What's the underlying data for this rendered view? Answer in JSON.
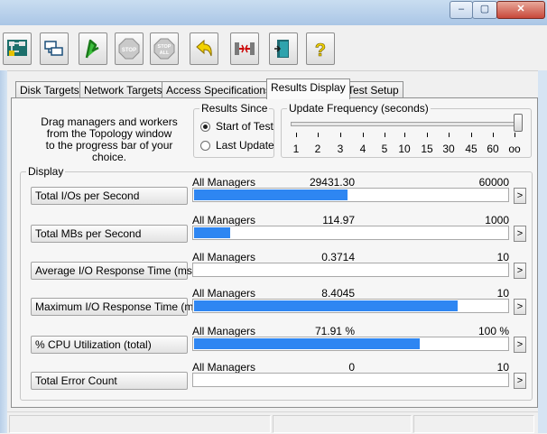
{
  "tabs": [
    {
      "label": "Disk Targets"
    },
    {
      "label": "Network Targets"
    },
    {
      "label": "Access Specifications"
    },
    {
      "label": "Results Display"
    },
    {
      "label": "Test Setup"
    }
  ],
  "description": {
    "line1": "Drag managers and workers",
    "line2": "from the Topology window",
    "line3": "to the progress bar of your choice."
  },
  "results_since": {
    "title": "Results Since",
    "options": [
      {
        "label": "Start of Test",
        "selected": true
      },
      {
        "label": "Last Update",
        "selected": false
      }
    ]
  },
  "update_frequency": {
    "title": "Update Frequency (seconds)",
    "ticks": [
      "1",
      "2",
      "3",
      "4",
      "5",
      "10",
      "15",
      "30",
      "45",
      "60",
      "oo"
    ],
    "selected_index": 10
  },
  "display": {
    "title": "Display",
    "rows": [
      {
        "label": "Total I/Os per Second",
        "manager": "All Managers",
        "value": "29431.30",
        "max": "60000",
        "fraction": 0.4905
      },
      {
        "label": "Total MBs per Second",
        "manager": "All Managers",
        "value": "114.97",
        "max": "1000",
        "fraction": 0.115
      },
      {
        "label": "Average I/O Response Time (ms)",
        "manager": "All Managers",
        "value": "0.3714",
        "max": "10",
        "fraction": 0.0
      },
      {
        "label": "Maximum I/O Response Time (ms)",
        "manager": "All Managers",
        "value": "8.4045",
        "max": "10",
        "fraction": 0.8405
      },
      {
        "label": "% CPU Utilization (total)",
        "manager": "All Managers",
        "value": "71.91 %",
        "max": "100 %",
        "fraction": 0.7191
      },
      {
        "label": "Total Error Count",
        "manager": "All Managers",
        "value": "0",
        "max": "10",
        "fraction": 0.0
      }
    ],
    "arrow": ">"
  },
  "window_controls": {
    "minimize": "–",
    "maximize": "▢",
    "close": "✕"
  },
  "toolbar": {
    "stop_label": "STOP",
    "stop_all_label": "STOP ALL",
    "help_label": "?"
  }
}
